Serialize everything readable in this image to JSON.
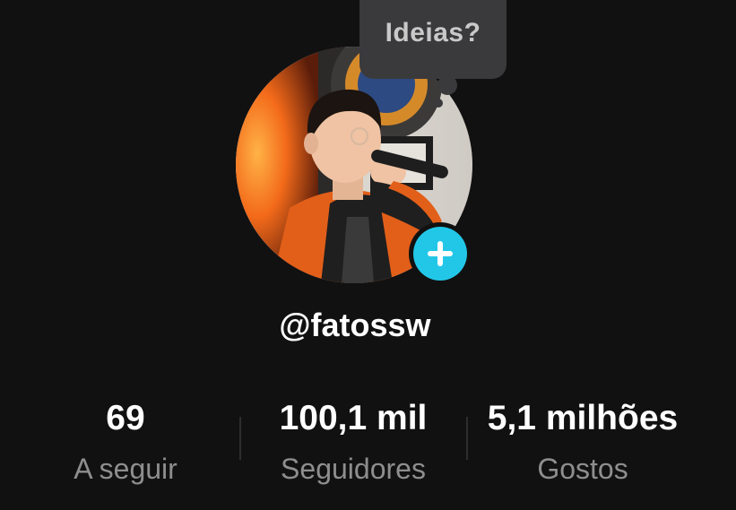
{
  "tooltip": {
    "text": "Ideias?"
  },
  "profile": {
    "username": "@fatossw",
    "avatar_alt": "profile photo",
    "add_icon": "plus-icon"
  },
  "stats": {
    "following": {
      "value": "69",
      "label": "A seguir"
    },
    "followers": {
      "value": "100,1 mil",
      "label": "Seguidores"
    },
    "likes": {
      "value": "5,1 milhões",
      "label": "Gostos"
    }
  },
  "colors": {
    "background": "#111111",
    "accent": "#22c7e8",
    "tooltip_bg": "#3a3a3c",
    "secondary_text": "#8e8e8e"
  }
}
